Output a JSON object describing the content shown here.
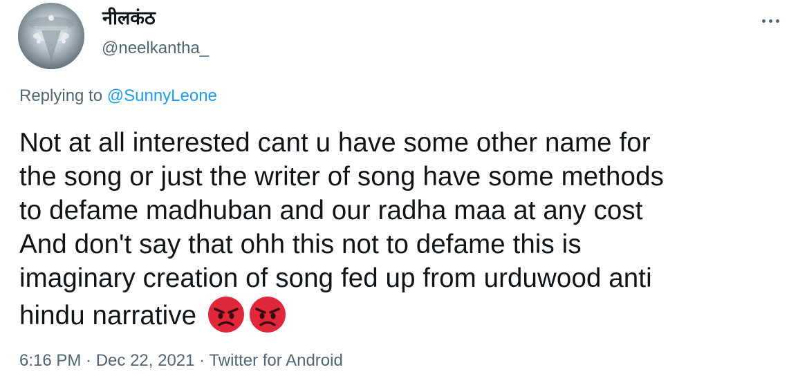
{
  "author": {
    "display_name": "नीलकंठ",
    "handle": "@neelkantha_"
  },
  "more_icon": "more-horizontal-icon",
  "reply": {
    "prefix": "Replying to ",
    "mention": "@SunnyLeone"
  },
  "tweet": {
    "lines": [
      "Not at all interested cant u have some other name for",
      "the song or just the writer of song have some methods",
      "to defame madhuban and our radha maa at any cost",
      "And don't say that ohh this not to defame this is",
      "imaginary creation of song fed up from urduwood anti",
      "hindu narrative"
    ],
    "emojis": [
      "angry-face-icon",
      "angry-face-icon"
    ]
  },
  "meta": {
    "time": "6:16 PM",
    "sep1": " · ",
    "date": "Dec 22, 2021",
    "sep2": " · ",
    "source": "Twitter for Android"
  },
  "colors": {
    "text": "#0f1419",
    "secondary": "#536471",
    "link": "#1d9bf0",
    "emoji_red": "#e0283a"
  }
}
